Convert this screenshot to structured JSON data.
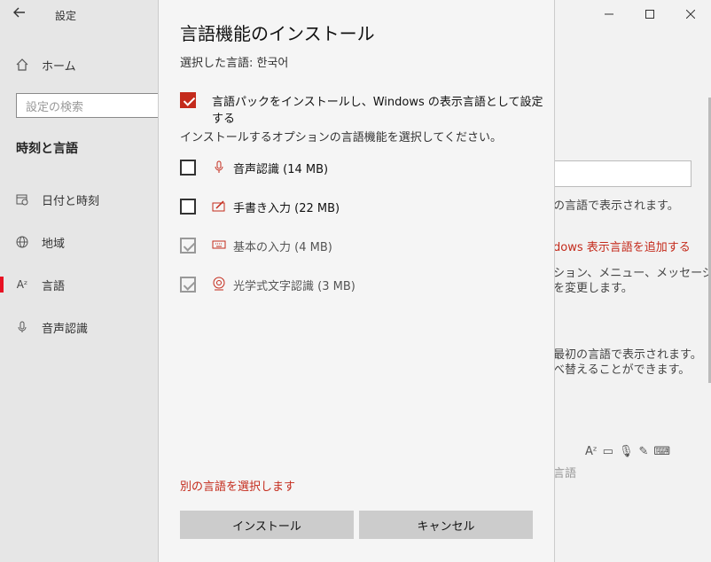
{
  "window": {
    "title": "設定",
    "controls": [
      "minimize",
      "maximize",
      "close"
    ]
  },
  "sidebar": {
    "home": "ホーム",
    "search_placeholder": "設定の検索",
    "section": "時刻と言語",
    "items": [
      {
        "label": "日付と時刻",
        "icon": "calendar-clock-icon",
        "selected": false
      },
      {
        "label": "地域",
        "icon": "globe-icon",
        "selected": false
      },
      {
        "label": "言語",
        "icon": "language-icon",
        "selected": true
      },
      {
        "label": "音声認識",
        "icon": "microphone-icon",
        "selected": false
      }
    ]
  },
  "background": {
    "line1": "の言語で表示されます。",
    "link": "dows 表示言語を追加する",
    "line2a": "ション、メニュー、メッセージ、",
    "line2b": "を変更します。",
    "line3a": "最初の言語で表示されます。",
    "line3b": "べ替えることができます。",
    "line4": "言語",
    "icons": [
      "language-icon",
      "display-icon",
      "microphone-icon",
      "handwriting-icon",
      "keyboard-icon"
    ]
  },
  "dialog": {
    "title": "言語機能のインストール",
    "selected_language_label": "選択した言語: 한국어",
    "install_pack": {
      "label": "言語パックをインストールし、Windows の表示言語として設定する",
      "checked": true
    },
    "instructions": "インストールするオプションの言語機能を選択してください。",
    "options": [
      {
        "label": "音声認識 (14 MB)",
        "icon": "microphone-icon",
        "checked": false,
        "disabled": false
      },
      {
        "label": "手書き入力 (22 MB)",
        "icon": "handwriting-icon",
        "checked": false,
        "disabled": false
      },
      {
        "label": "基本の入力 (4 MB)",
        "icon": "keyboard-icon",
        "checked": true,
        "disabled": true
      },
      {
        "label": "光学式文字認識 (3 MB)",
        "icon": "ocr-icon",
        "checked": true,
        "disabled": true
      }
    ],
    "choose_other_link": "別の言語を選択します",
    "install_button": "インストール",
    "cancel_button": "キャンセル"
  },
  "colors": {
    "accent": "#c42b1c",
    "button_bg": "#cccccc",
    "sidebar_bg": "#e6e6e6"
  }
}
